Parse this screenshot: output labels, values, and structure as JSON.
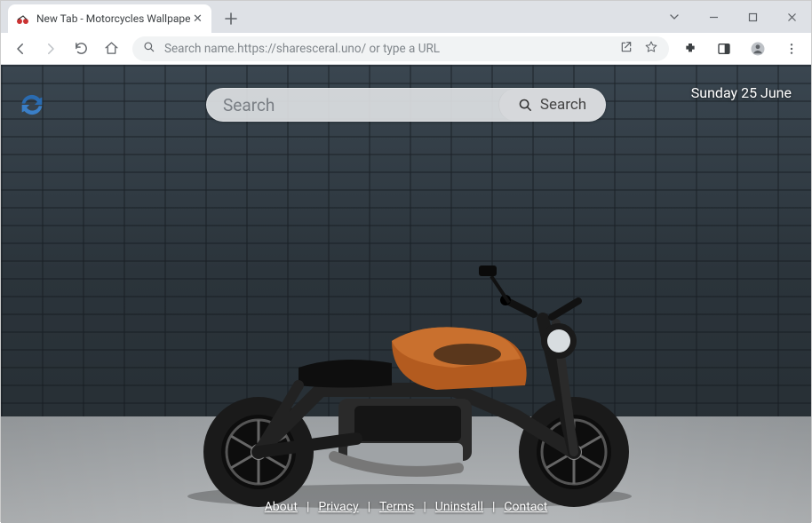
{
  "tab": {
    "title": "New Tab - Motorcycles Wallpape"
  },
  "omnibox": {
    "placeholder": "Search name.https://sharesceral.uno/ or type a URL"
  },
  "page": {
    "date": "Sunday 25 June",
    "search_placeholder": "Search",
    "search_button": "Search"
  },
  "footer": {
    "about": "About",
    "privacy": "Privacy",
    "terms": "Terms",
    "uninstall": "Uninstall",
    "contact": "Contact",
    "sep": "|"
  }
}
